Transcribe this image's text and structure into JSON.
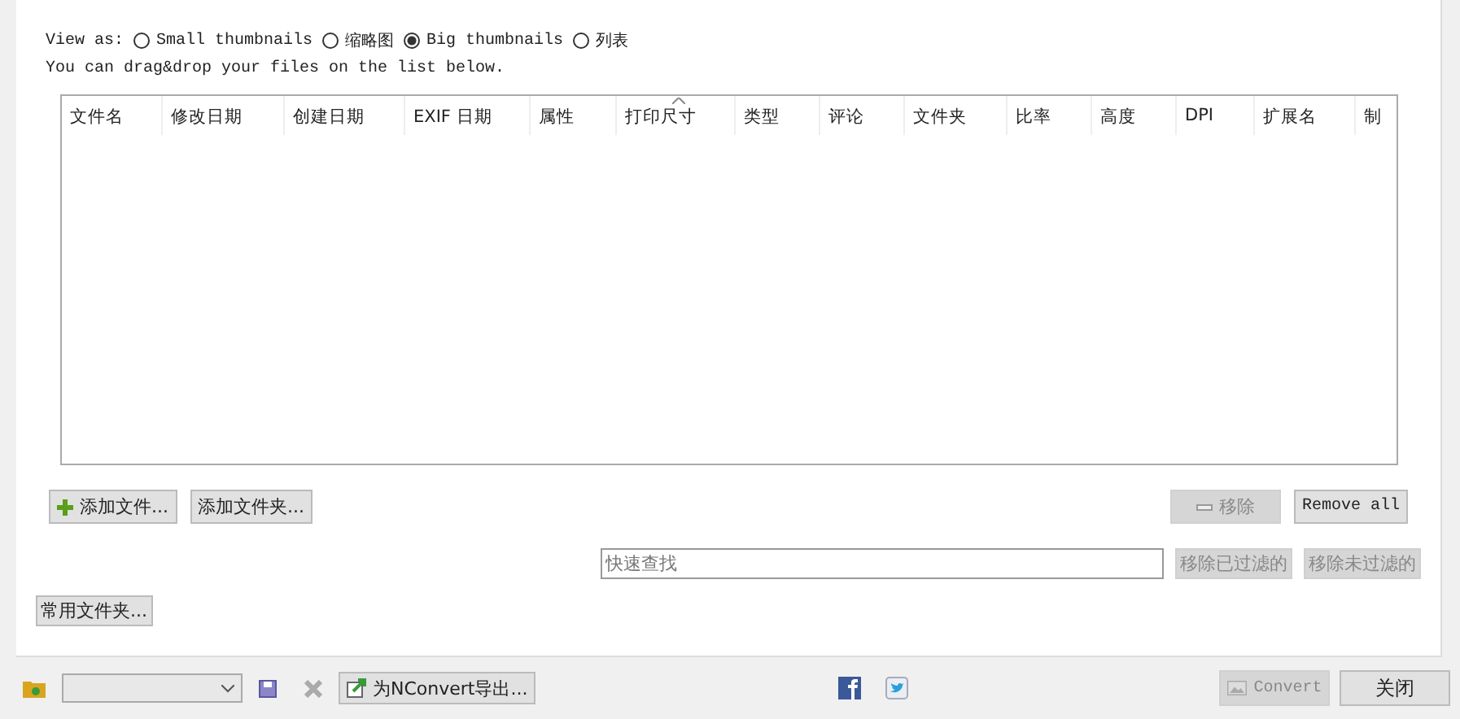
{
  "view_as": {
    "label": "View as:",
    "options": [
      {
        "label": "Small thumbnails",
        "selected": false
      },
      {
        "label": "缩略图",
        "selected": false
      },
      {
        "label": "Big thumbnails",
        "selected": true
      },
      {
        "label": "列表",
        "selected": false
      }
    ]
  },
  "hint": "You can drag&drop your files on the list below.",
  "table": {
    "columns": [
      {
        "label": "文件名",
        "sorted": false
      },
      {
        "label": "修改日期",
        "sorted": false
      },
      {
        "label": "创建日期",
        "sorted": false
      },
      {
        "label": "EXIF 日期",
        "sorted": false
      },
      {
        "label": "属性",
        "sorted": false
      },
      {
        "label": "打印尺寸",
        "sorted": true
      },
      {
        "label": "类型",
        "sorted": false
      },
      {
        "label": "评论",
        "sorted": false
      },
      {
        "label": "文件夹",
        "sorted": false
      },
      {
        "label": "比率",
        "sorted": false
      },
      {
        "label": "高度",
        "sorted": false
      },
      {
        "label": "DPI",
        "sorted": false
      },
      {
        "label": "扩展名",
        "sorted": false
      },
      {
        "label": "制",
        "sorted": false
      }
    ]
  },
  "add_buttons": [
    {
      "label": "添加文件...",
      "icon": true
    },
    {
      "label": "添加文件夹...",
      "icon": false
    }
  ],
  "remove_button": {
    "label": "移除",
    "disabled": true
  },
  "remove_all_button": {
    "label": "Remove all",
    "disabled": false
  },
  "quick_search": {
    "placeholder": "快速查找"
  },
  "filter_buttons": [
    {
      "label": "移除已过滤的",
      "disabled": true
    },
    {
      "label": "移除未过滤的",
      "disabled": true
    }
  ],
  "favorites_button": {
    "label": "常用文件夹..."
  },
  "export_button": {
    "label": "为NConvert导出..."
  },
  "convert_button": {
    "label": "Convert",
    "disabled": true
  },
  "close_button": {
    "label": "关闭"
  }
}
